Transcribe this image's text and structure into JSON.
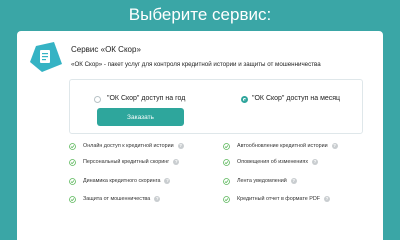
{
  "header": {
    "title": "Выберите сервис:"
  },
  "service": {
    "title": "Сервис «ОК Скор»",
    "description": "«ОК Скор» - пакет услуг для контроля кредитной истории и защиты от мошенничества"
  },
  "options": [
    {
      "label": "\"ОК Скор\" доступ на год",
      "selected": false
    },
    {
      "label": "\"ОК Скор\" доступ на месяц",
      "selected": true
    }
  ],
  "order_button": {
    "label": "Заказать"
  },
  "features_left": [
    "Онлайн доступ к кредитной истории",
    "Персональный кредитный скоринг",
    "Динамика кредитного скоринга",
    "Защита от мошенничества"
  ],
  "features_right": [
    "Автообновление кредитной истории",
    "Оповещения об изменениях",
    "Лента уведомлений",
    "Кредитный отчет в формате PDF"
  ],
  "help_glyph": "?",
  "colors": {
    "background": "#3aa6a6",
    "accent": "#2ea69c",
    "check": "#5cb85c"
  }
}
